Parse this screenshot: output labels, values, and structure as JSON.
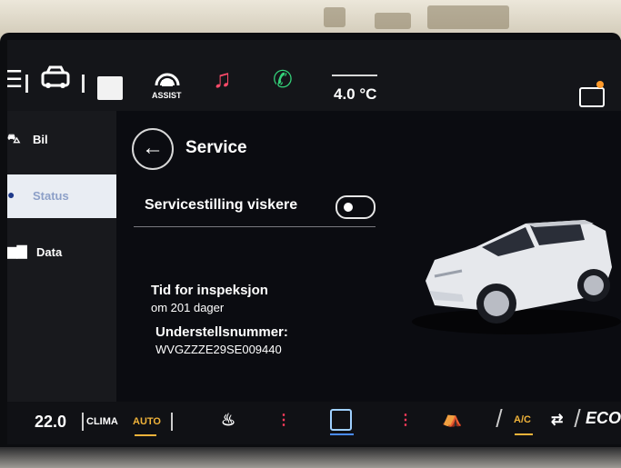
{
  "topbar": {
    "temperature": "4.0 °C",
    "assist_label": "ASSIST"
  },
  "sidebar": {
    "items": [
      {
        "label": "Bil"
      },
      {
        "label": "Status"
      },
      {
        "label": "Data"
      }
    ]
  },
  "main": {
    "title": "Service",
    "wiper_setting_label": "Servicestilling viskere",
    "wiper_toggle_on": false,
    "inspection_heading": "Tid for inspeksjon",
    "inspection_value": "om 201 dager",
    "vin_heading": "Understellsnummer:",
    "vin_value": "WVGZZZE29SE009440"
  },
  "climate": {
    "temperature": "22.0",
    "clima_label": "CLIMA",
    "auto_label": "AUTO",
    "ac_label": "A/C",
    "eco_label": "ECO"
  },
  "colors": {
    "accent_orange": "#f0b33a",
    "active_blue": "#1f3a8a",
    "heat_red": "#ff3b5c"
  }
}
